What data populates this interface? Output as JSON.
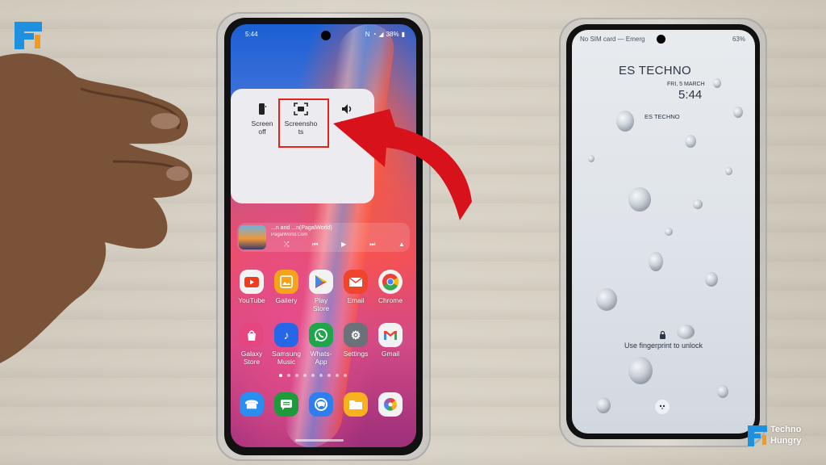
{
  "brand": {
    "name_line1": "Techno",
    "name_line2": "Hungry",
    "colors": {
      "blue": "#1e90e0",
      "orange": "#f39a1e"
    }
  },
  "annotation": {
    "highlight_color": "#e2231a",
    "arrow_color": "#d8121a",
    "arrow_target": "Screenshots"
  },
  "left_phone": {
    "status_bar": {
      "time": "5:44",
      "battery": "38%",
      "icons": [
        "nfc-icon",
        "wifi-icon",
        "signal-icon"
      ]
    },
    "popup": {
      "items": [
        {
          "icon": "screen-off-icon",
          "label_line1": "Screen",
          "label_line2": "off"
        },
        {
          "icon": "screenshot-icon",
          "label_line1": "Screensho",
          "label_line2": "ts"
        },
        {
          "icon": "volume-icon",
          "label_line1": "Volu",
          "label_line2": ""
        }
      ]
    },
    "music_widget": {
      "title": "...n and ...n(PagalWorld)",
      "subtitle": "PagalWorld.Com",
      "controls": [
        "shuffle",
        "previous",
        "play",
        "next",
        "cast"
      ]
    },
    "apps_row1": [
      {
        "name": "YouTube",
        "label": "YouTube",
        "color": "#ff0000",
        "bg": "#f2f2f2"
      },
      {
        "name": "Gallery",
        "label": "Gallery",
        "color": "#ffffff",
        "bg": "#f7a21b"
      },
      {
        "name": "Play Store",
        "label_line1": "Play",
        "label_line2": "Store",
        "bg": "#f2f2f2"
      },
      {
        "name": "Email",
        "label": "Email",
        "bg": "#f0442c"
      },
      {
        "name": "Chrome",
        "label": "Chrome",
        "bg": "#f2f2f2"
      }
    ],
    "apps_row2": [
      {
        "name": "Galaxy Store",
        "label_line1": "Galaxy",
        "label_line2": "Store",
        "bg": "#e5467f"
      },
      {
        "name": "Samsung Music",
        "label_line1": "Samsung",
        "label_line2": "Music",
        "bg": "#2667e8"
      },
      {
        "name": "WhatsApp",
        "label_line1": "Whats-",
        "label_line2": "App",
        "bg": "#1fa64a"
      },
      {
        "name": "Settings",
        "label": "Settings",
        "bg": "#6b7178"
      },
      {
        "name": "Gmail",
        "label": "Gmail",
        "bg": "#f2f2f2"
      }
    ],
    "page_dots": {
      "count": 9,
      "active_index": 0
    },
    "dock": [
      {
        "name": "Phone",
        "bg": "#2a8ef0"
      },
      {
        "name": "Messages",
        "bg": "#1d9a3a"
      },
      {
        "name": "Internet",
        "bg": "#2f7ef0"
      },
      {
        "name": "My Files",
        "bg": "#f8b21d"
      },
      {
        "name": "Photos",
        "bg": "#f2f2f2"
      }
    ]
  },
  "right_phone": {
    "status_bar": {
      "carrier_text": "No SIM card — Emerg",
      "battery": "63%"
    },
    "lock_screen": {
      "brand": "ES TECHNO",
      "date": "FRI, 5 MARCH",
      "time": "5:44",
      "owner_info": "ES TECHNO",
      "unlock_hint": "Use fingerprint to unlock"
    }
  }
}
